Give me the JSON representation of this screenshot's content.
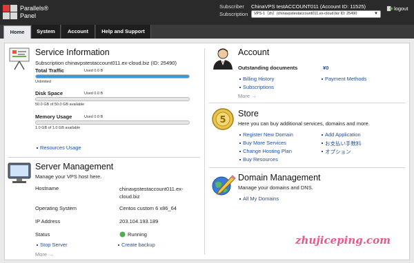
{
  "header": {
    "logo_line1": "Parallels®",
    "logo_line2": "Panel",
    "subscriber_label": "Subscriber",
    "subscriber_value": "ChinaVPS  testACCOUNT011 (Account ID: 11525)",
    "subscription_label": "Subscription",
    "subscription_select": "VPS-1（zh）(chinavpstestaccount011.ex-cloud.biz ID: 25490",
    "logout": "logout"
  },
  "tabs": [
    {
      "label": "Home"
    },
    {
      "label": "System"
    },
    {
      "label": "Account"
    },
    {
      "label": "Help and Support"
    }
  ],
  "service": {
    "title": "Service Information",
    "subscription": "Subscription chinavpstestaccount011.ex-cloud.biz (ID: 25490)",
    "metrics": [
      {
        "name": "Total Traffic",
        "used": "Used 0.0 B",
        "detail": "Unlimited",
        "fill": 1.0
      },
      {
        "name": "Disk Space",
        "used": "Used 0.0 B",
        "detail": "50.0 GB of 50.0 GB available",
        "fill": 0.0
      },
      {
        "name": "Memory Usage",
        "used": "Used 0.0 B",
        "detail": "1.0 GB of 1.0 GB available",
        "fill": 0.0
      }
    ],
    "resources_link": "Resources Usage"
  },
  "server": {
    "title": "Server Management",
    "subtitle": "Manage your VPS host here.",
    "rows": [
      {
        "label": "Hostname",
        "value": "chinavpstestaccount011.ex-cloud.biz"
      },
      {
        "label": "Operating System",
        "value": "Centos custom 6 x86_64"
      },
      {
        "label": "IP Address",
        "value": "203.104.193.189"
      },
      {
        "label": "Status",
        "value": "Running"
      }
    ],
    "stop_server": "Stop Server",
    "create_backup": "Create backup",
    "more": "More →"
  },
  "account": {
    "title": "Account",
    "outstanding_label": "Outstanding documents",
    "outstanding_value": "¥0",
    "links": [
      "Billing History",
      "Payment Methods",
      "Subscriptions"
    ],
    "more": "More →"
  },
  "store": {
    "title": "Store",
    "subtitle": "Here you can buy additional services, domains and more.",
    "links_left": [
      "Register New Domain",
      "Buy More Services",
      "Change Hosting Plan",
      "Buy Resources"
    ],
    "links_right": [
      "Add Application",
      "お支払い手数料",
      "オプション"
    ]
  },
  "domain": {
    "title": "Domain Management",
    "subtitle": "Manage your domains and DNS.",
    "link": "All My Domains"
  },
  "watermark": "zhujiceping.com"
}
